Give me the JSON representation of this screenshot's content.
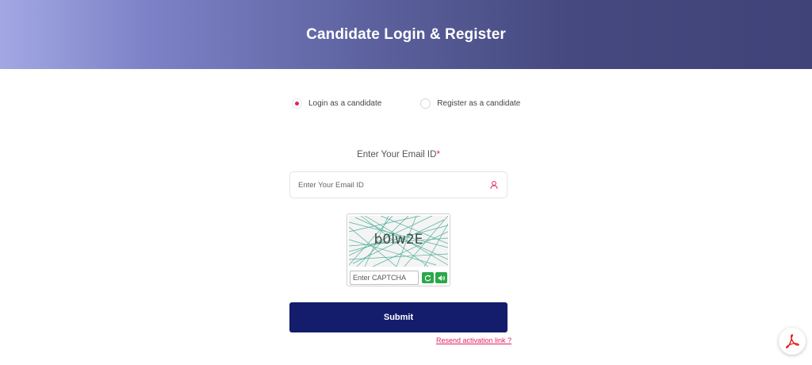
{
  "header": {
    "title": "Candidate Login & Register"
  },
  "mode": {
    "options": [
      {
        "label": "Login as a candidate",
        "checked": true
      },
      {
        "label": "Register as a candidate",
        "checked": false
      }
    ]
  },
  "email": {
    "label": "Enter Your Email ID",
    "required_mark": "*",
    "placeholder": "Enter Your Email ID",
    "value": ""
  },
  "captcha": {
    "code": "b0lw2E",
    "input_placeholder": "Enter CAPTCHA",
    "refresh_icon": "refresh-icon",
    "audio_icon": "speaker-icon"
  },
  "actions": {
    "submit_label": "Submit",
    "resend_label": "Resend activation link ?"
  },
  "floating": {
    "icon": "pdf-icon"
  },
  "colors": {
    "accent": "#e0245e",
    "primary_button": "#141d6c",
    "captcha_button": "#2aa84a"
  }
}
